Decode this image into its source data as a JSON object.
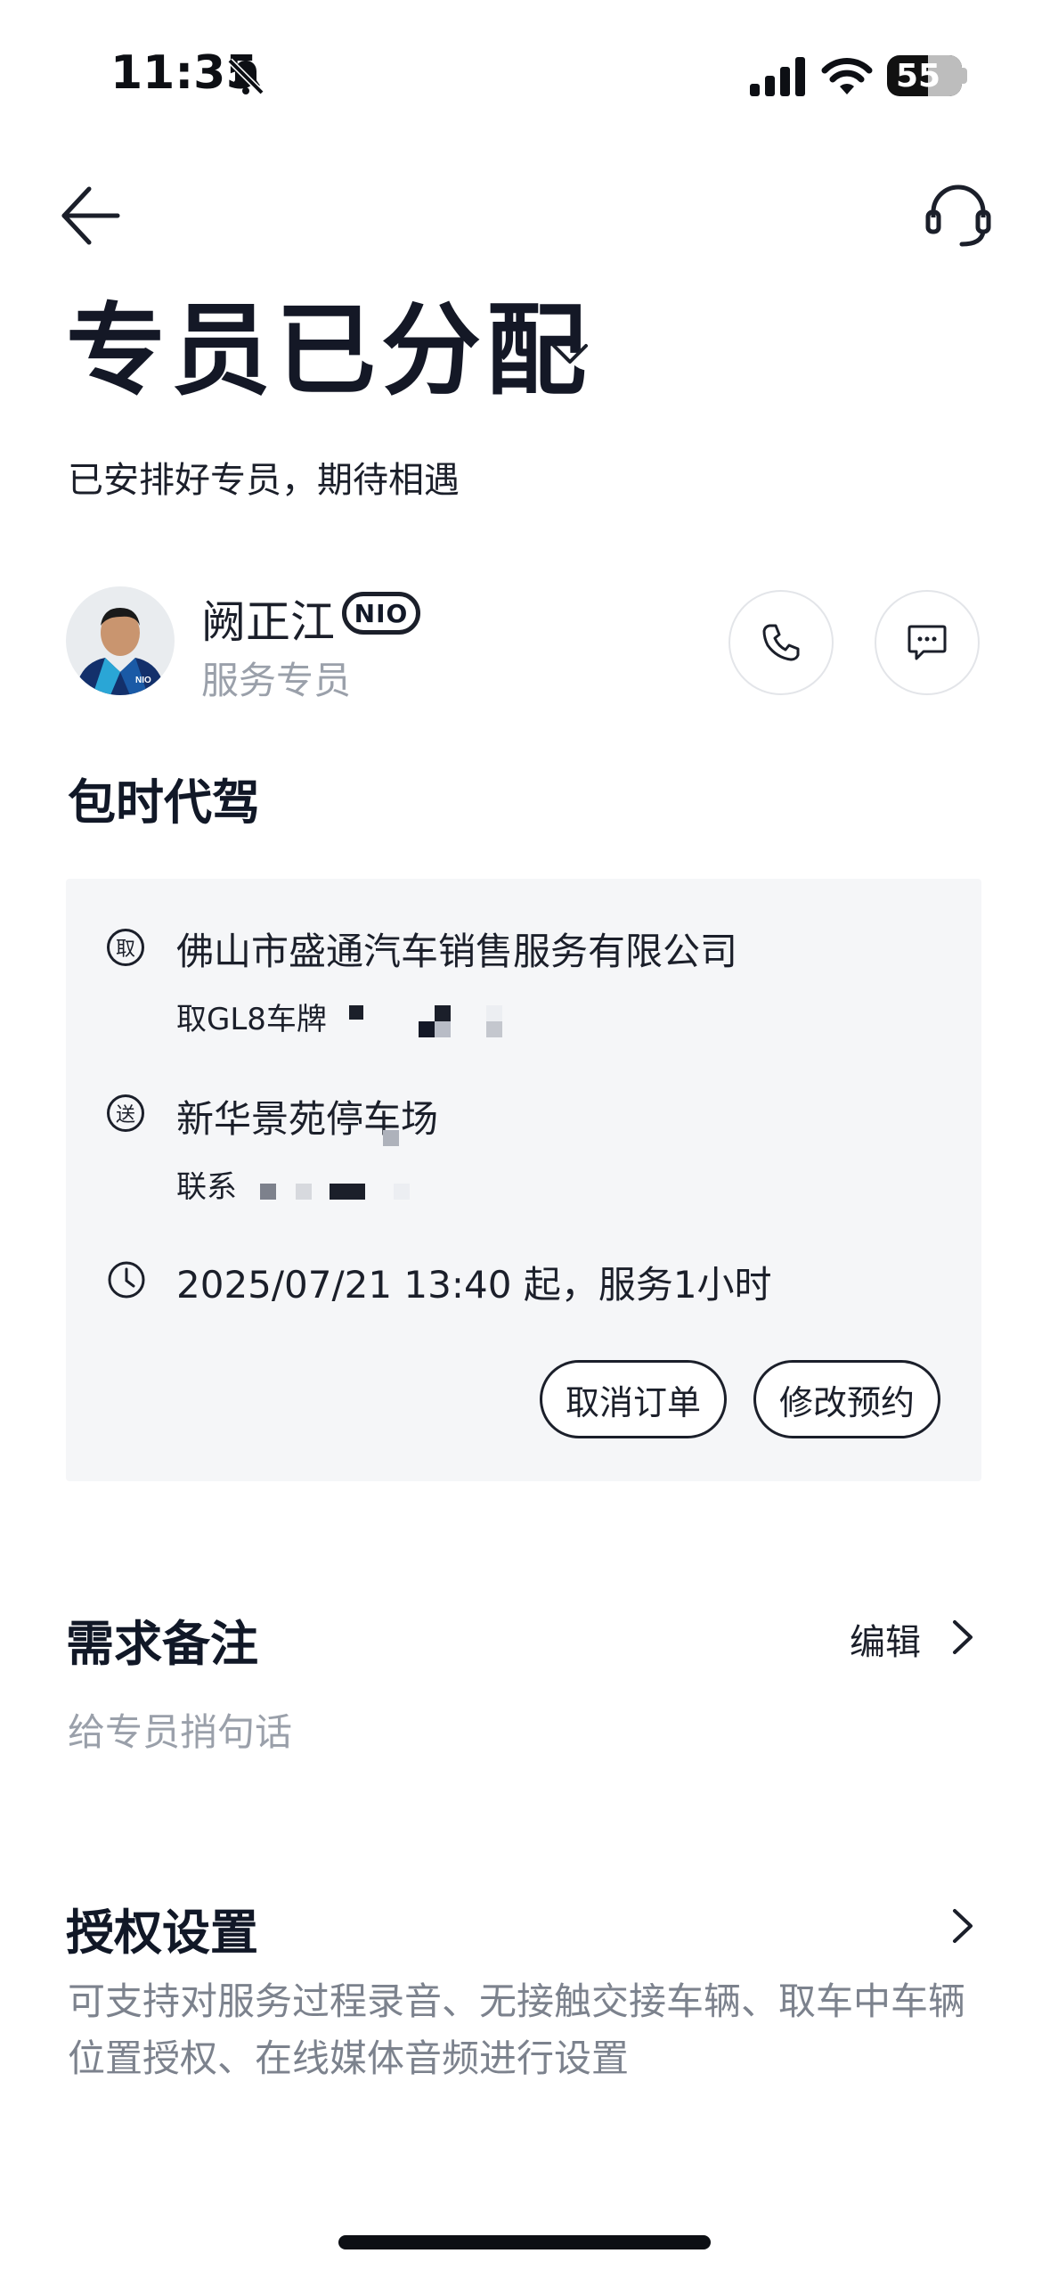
{
  "status_bar": {
    "time": "11:35",
    "battery": "55"
  },
  "header": {
    "title": "专员已分配",
    "subtitle": "已安排好专员，期待相遇"
  },
  "specialist": {
    "name": "阙正江",
    "badge": "NIO",
    "role": "服务专员",
    "jacket_logo": "NIO"
  },
  "service": {
    "title": "包时代驾",
    "pickup": {
      "icon_label": "取",
      "name": "佛山市盛通汽车销售服务有限公司",
      "note": "取GL8车牌"
    },
    "dropoff": {
      "icon_label": "送",
      "name": "新华景苑停车场",
      "note": "联系"
    },
    "time": "2025/07/21 13:40 起，服务1小时",
    "cancel_label": "取消订单",
    "modify_label": "修改预约"
  },
  "remarks": {
    "title": "需求备注",
    "edit_label": "编辑",
    "placeholder": "给专员捎句话"
  },
  "authorization": {
    "title": "授权设置",
    "description": "可支持对服务过程录音、无接触交接车辆、取车中车辆位置授权、在线媒体音频进行设置"
  }
}
